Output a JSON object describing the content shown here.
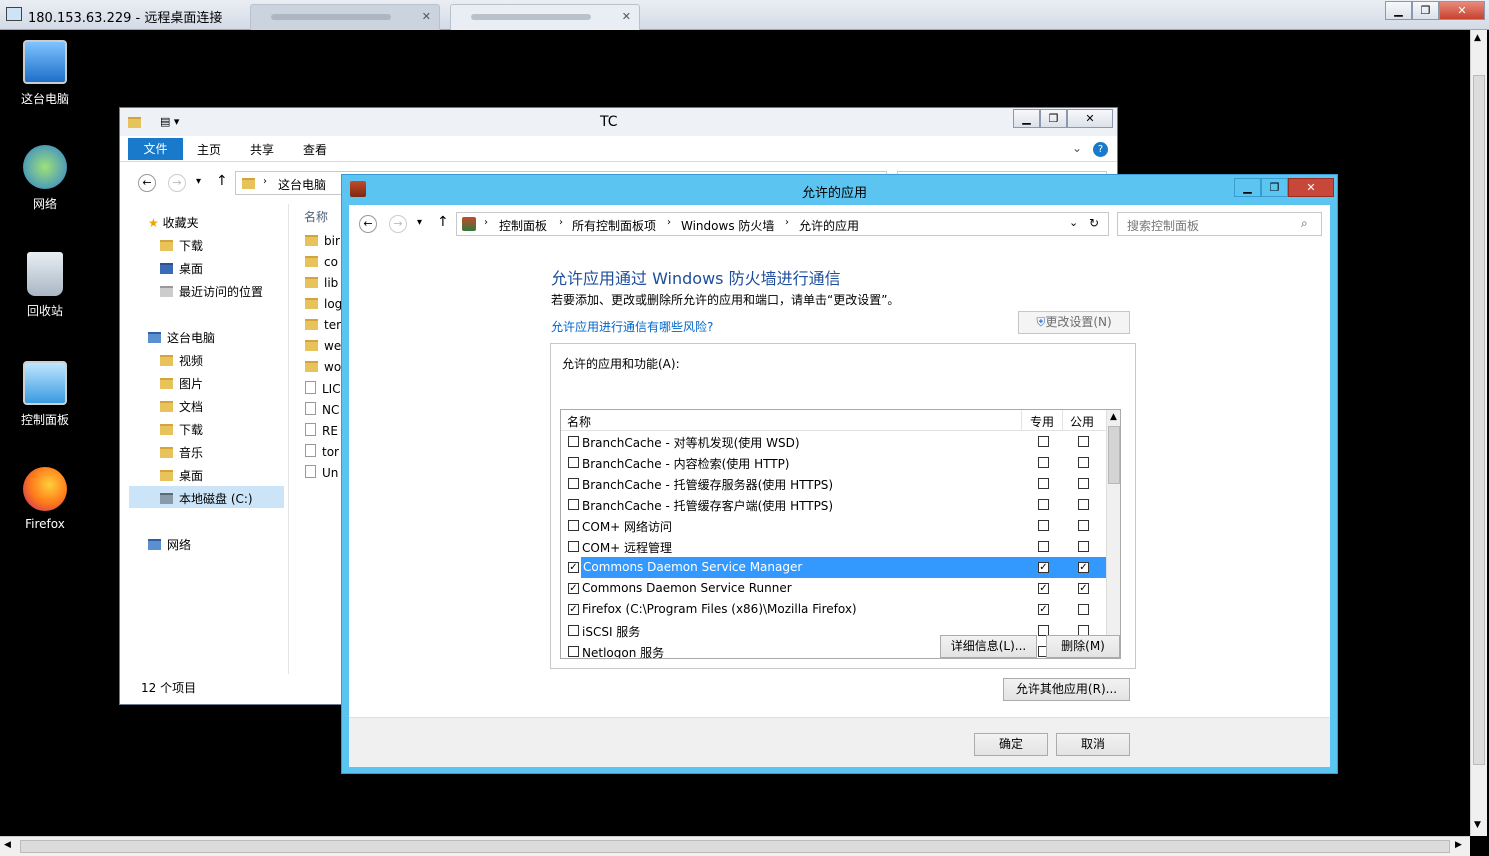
{
  "rdp": {
    "title": "180.153.63.229 - 远程桌面连接",
    "tabs": [
      "",
      ""
    ]
  },
  "desktop": {
    "icons": [
      {
        "label": "这台电脑",
        "icon": "computer-icon"
      },
      {
        "label": "网络",
        "icon": "network-icon"
      },
      {
        "label": "回收站",
        "icon": "recycle-bin-icon"
      },
      {
        "label": "控制面板",
        "icon": "control-panel-icon"
      },
      {
        "label": "Firefox",
        "icon": "firefox-icon"
      }
    ]
  },
  "explorer": {
    "title": "TC",
    "ribbon": {
      "file": "文件",
      "home": "主页",
      "share": "共享",
      "view": "查看"
    },
    "breadcrumb": "这台电脑",
    "column_name": "名称",
    "nav": {
      "favorites": "收藏夹",
      "fav_items": [
        "下载",
        "桌面",
        "最近访问的位置"
      ],
      "this_pc": "这台电脑",
      "pc_items": [
        "视频",
        "图片",
        "文档",
        "下载",
        "音乐",
        "桌面"
      ],
      "local_disk": "本地磁盘 (C:)",
      "network": "网络"
    },
    "files": [
      "bir",
      "co",
      "lib",
      "log",
      "ter",
      "we",
      "wo",
      "LIC",
      "NC",
      "RE",
      "tor",
      "Un"
    ],
    "status": "12 个项目"
  },
  "cp": {
    "title": "允许的应用",
    "breadcrumb": [
      "控制面板",
      "所有控制面板项",
      "Windows 防火墙",
      "允许的应用"
    ],
    "search_placeholder": "搜索控制面板",
    "heading": "允许应用通过 Windows 防火墙进行通信",
    "subtext": "若要添加、更改或删除所允许的应用和端口，请单击“更改设置”。",
    "risk_link": "允许应用进行通信有哪些风险?",
    "change_settings": "更改设置(N)",
    "group_label": "允许的应用和功能(A):",
    "col_name": "名称",
    "col_private": "专用",
    "col_public": "公用",
    "rows": [
      {
        "name": "BranchCache - 对等机发现(使用 WSD)",
        "on": false,
        "private": false,
        "public": false
      },
      {
        "name": "BranchCache - 内容检索(使用 HTTP)",
        "on": false,
        "private": false,
        "public": false
      },
      {
        "name": "BranchCache - 托管缓存服务器(使用 HTTPS)",
        "on": false,
        "private": false,
        "public": false
      },
      {
        "name": "BranchCache - 托管缓存客户端(使用 HTTPS)",
        "on": false,
        "private": false,
        "public": false
      },
      {
        "name": "COM+ 网络访问",
        "on": false,
        "private": false,
        "public": false
      },
      {
        "name": "COM+ 远程管理",
        "on": false,
        "private": false,
        "public": false
      },
      {
        "name": "Commons Daemon Service Manager",
        "on": true,
        "private": true,
        "public": true,
        "selected": true
      },
      {
        "name": "Commons Daemon Service Runner",
        "on": true,
        "private": true,
        "public": true
      },
      {
        "name": "Firefox (C:\\Program Files (x86)\\Mozilla Firefox)",
        "on": true,
        "private": true,
        "public": false
      },
      {
        "name": "iSCSI 服务",
        "on": false,
        "private": false,
        "public": false
      },
      {
        "name": "Netlogon 服务",
        "on": false,
        "private": false,
        "public": false
      }
    ],
    "details_btn": "详细信息(L)...",
    "remove_btn": "删除(M)",
    "allow_other_btn": "允许其他应用(R)...",
    "ok_btn": "确定",
    "cancel_btn": "取消"
  }
}
